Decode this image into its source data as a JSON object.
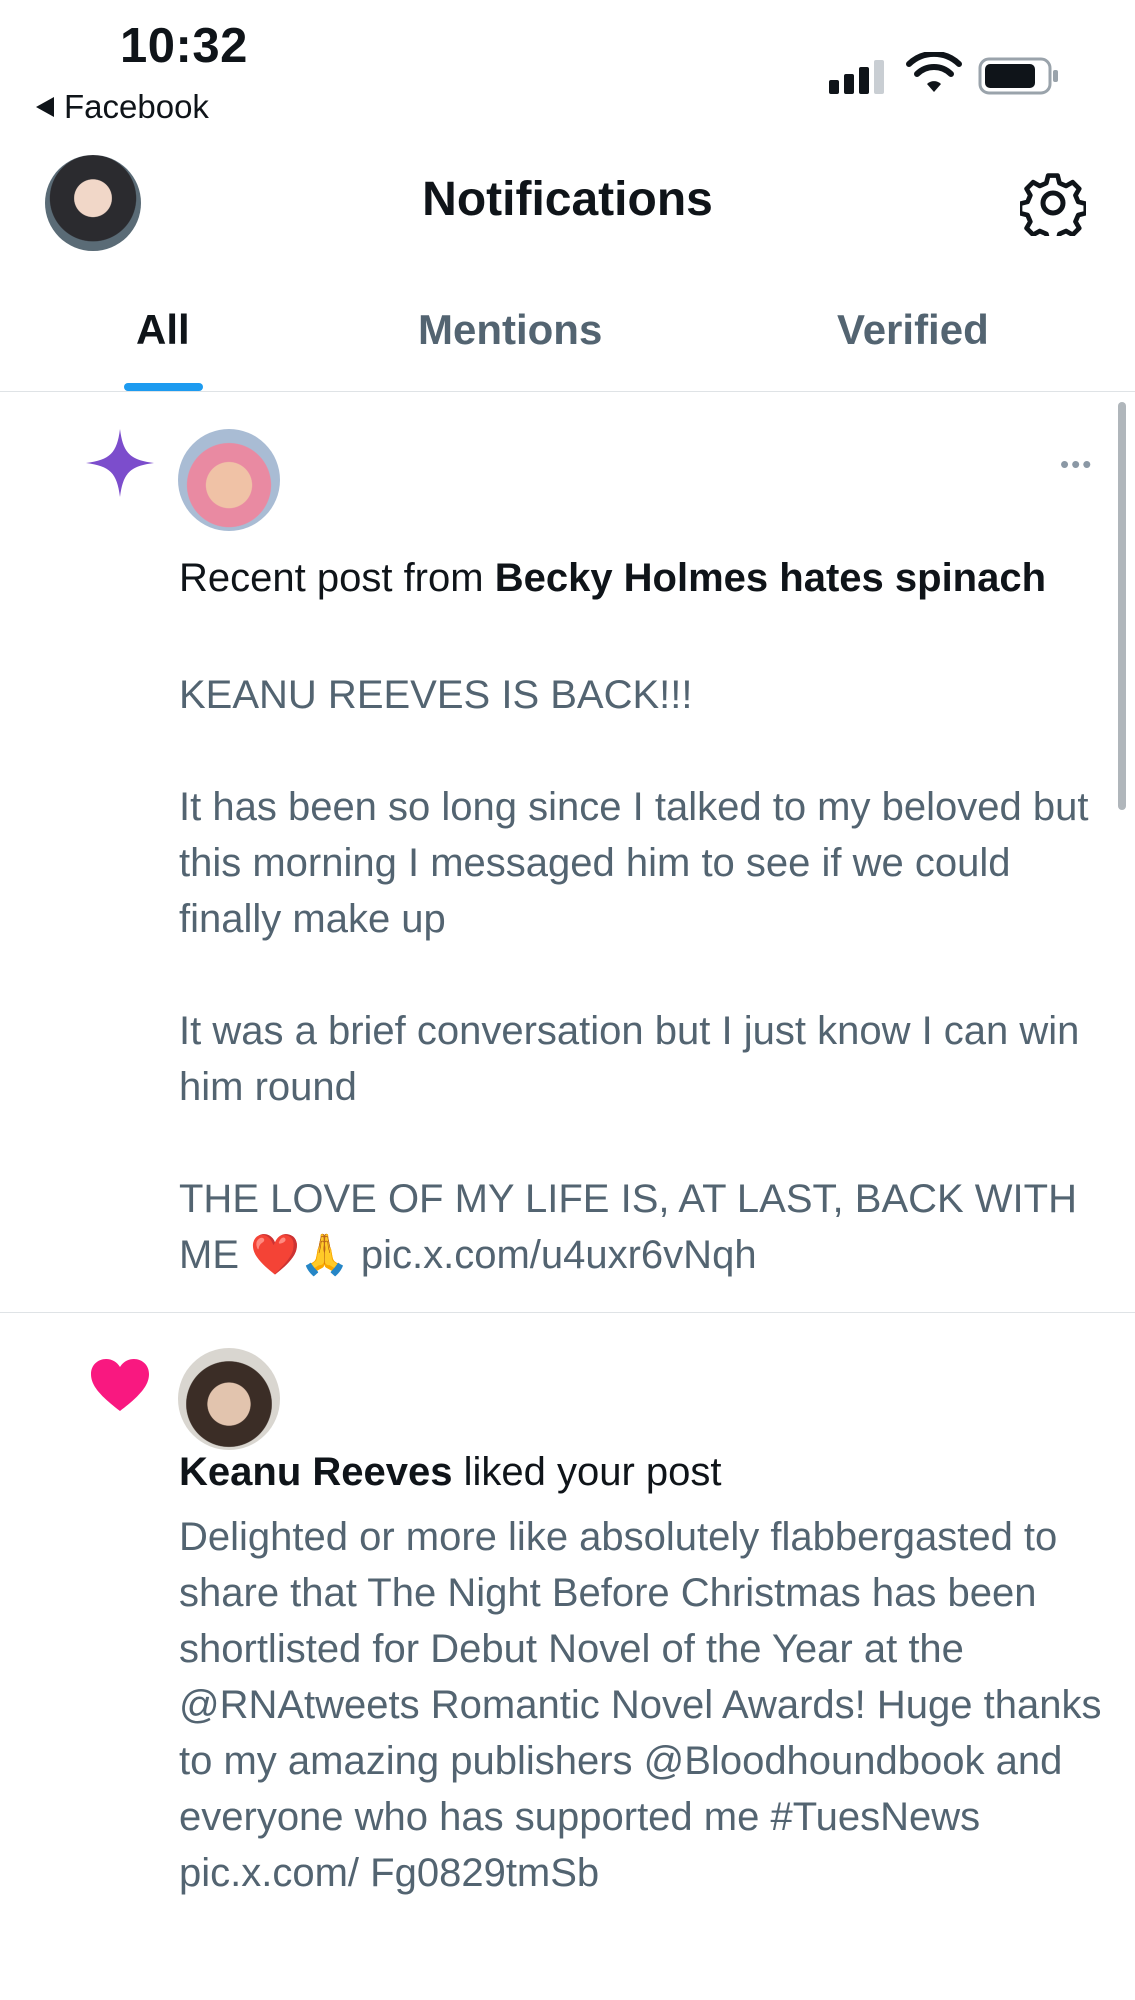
{
  "status_bar": {
    "time": "10:32",
    "back_app": "Facebook",
    "icons": [
      "cellular-signal-icon",
      "wifi-icon",
      "battery-icon"
    ]
  },
  "header": {
    "title": "Notifications",
    "avatar": "profile-avatar",
    "settings_icon": "gear-icon"
  },
  "tabs": [
    {
      "label": "All",
      "active": true
    },
    {
      "label": "Mentions",
      "active": false
    },
    {
      "label": "Verified",
      "active": false
    }
  ],
  "colors": {
    "accent": "#1d9bf0",
    "sparkle": "#7c4dcc",
    "like": "#f91880",
    "secondary_text": "#536471"
  },
  "notifications": [
    {
      "type": "recent-post",
      "icon": "sparkle-icon",
      "prefix": "Recent post from ",
      "user": "Becky Holmes hates spinach",
      "paragraphs": [
        "KEANU REEVES IS BACK!!!",
        "It has been so long since I talked to my beloved but this morning I messaged him to see if we could finally make up",
        "It was a brief conversation but I just know I can win him round",
        "THE LOVE OF MY LIFE IS, AT LAST, BACK WITH ME ❤️🙏 pic.x.com/u4uxr6vNqh"
      ]
    },
    {
      "type": "like",
      "icon": "heart-icon",
      "user": "Keanu Reeves",
      "suffix": " liked your post",
      "paragraphs": [
        "Delighted or more like absolutely flabbergasted to share that The Night Before Christmas has been shortlisted for Debut Novel of the Year at the @RNAtweets Romantic Novel Awards! Huge thanks to my amazing publishers @Bloodhoundbook and everyone who has supported me #TuesNews pic.x.com/ Fg0829tmSb"
      ]
    }
  ]
}
